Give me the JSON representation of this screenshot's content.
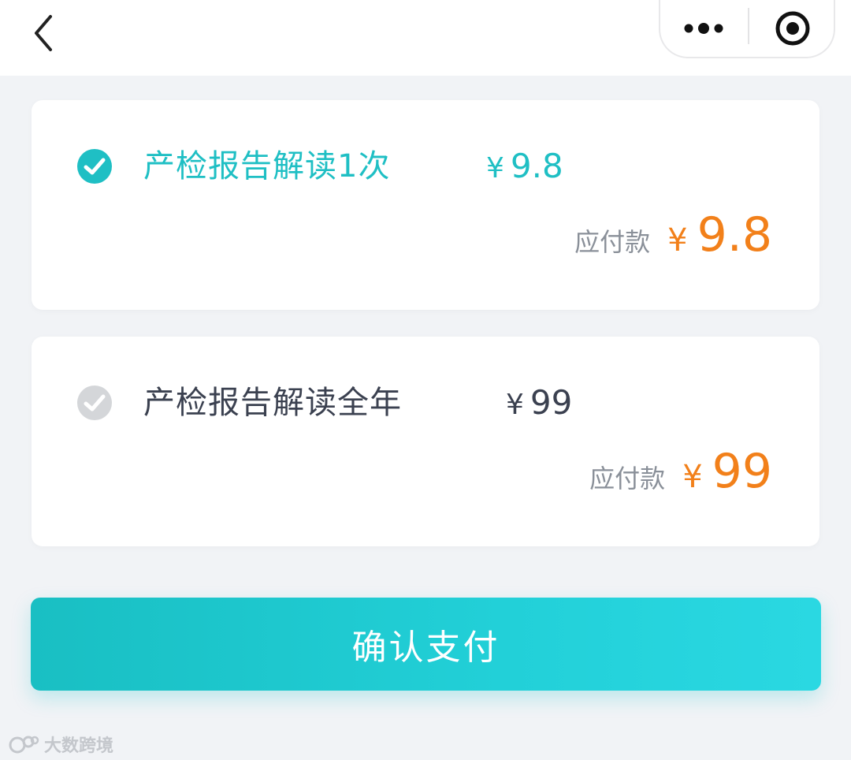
{
  "nav": {
    "back_icon": "chevron-left-icon",
    "more_icon": "more-dots-icon",
    "close_icon": "target-circle-icon"
  },
  "plans": [
    {
      "name": "产检报告解读1次",
      "price_symbol": "¥",
      "price": "9.8",
      "due_label": "应付款",
      "due_symbol": "¥",
      "due_value": "9.8",
      "selected": true
    },
    {
      "name": "产检报告解读全年",
      "price_symbol": "¥",
      "price": "99",
      "due_label": "应付款",
      "due_symbol": "¥",
      "due_value": "99",
      "selected": false
    }
  ],
  "confirm_label": "确认支付",
  "watermark_text": "大数跨境",
  "colors": {
    "accent": "#1fbfc4",
    "price_orange": "#f2801a",
    "text_dark": "#3b4150",
    "text_muted": "#8a9099",
    "unselected_radio": "#d4d6d9",
    "background": "#f1f3f6"
  }
}
